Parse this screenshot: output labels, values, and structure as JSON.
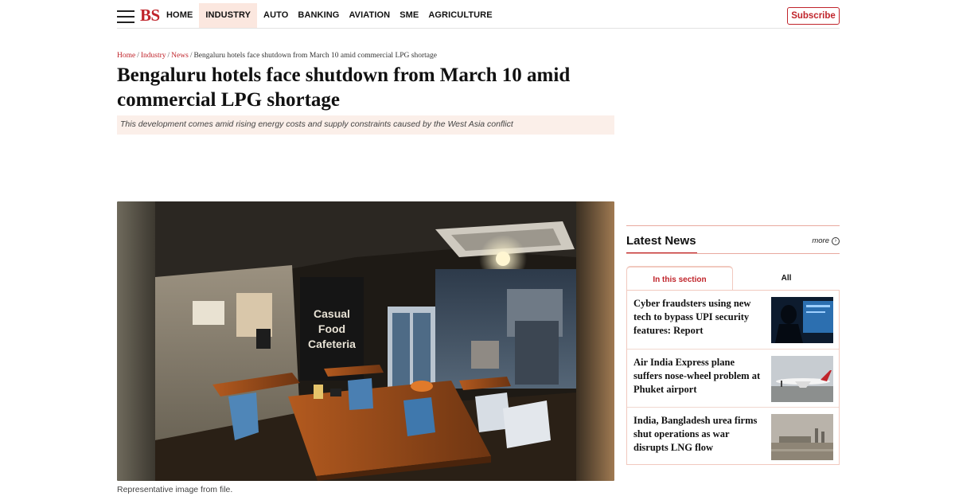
{
  "header": {
    "logo": "BS",
    "nav": [
      "HOME",
      "INDUSTRY",
      "AUTO",
      "BANKING",
      "AVIATION",
      "SME",
      "AGRICULTURE"
    ],
    "active_nav": "INDUSTRY",
    "subscribe_label": "Subscribe",
    "accent_color": "#c0242b"
  },
  "breadcrumb": {
    "items": [
      "Home",
      "Industry",
      "News"
    ],
    "separator": "/",
    "current": "Bengaluru hotels face shutdown from March 10 amid commercial LPG shortage"
  },
  "article": {
    "headline": "Bengaluru hotels face shutdown from March 10 amid commercial LPG shortage",
    "summary": "This development comes amid rising energy costs and supply constraints caused by the West Asia conflict",
    "image_sign_lines": [
      "Casual",
      "Food",
      "Cafeteria"
    ],
    "caption": "Representative image from file."
  },
  "sidebar": {
    "title": "Latest News",
    "more_label": "more",
    "tabs": [
      "In this section",
      "All"
    ],
    "active_tab": "In this section",
    "items": [
      {
        "title": "Cyber fraudsters using new tech to bypass UPI security features: Report",
        "thumb_icon": "person-at-screen-thumbnail"
      },
      {
        "title": "Air India Express plane suffers nose-wheel problem at Phuket airport",
        "thumb_icon": "airplane-thumbnail"
      },
      {
        "title": "India, Bangladesh urea firms shut operations as war disrupts LNG flow",
        "thumb_icon": "industrial-plant-thumbnail"
      }
    ]
  }
}
